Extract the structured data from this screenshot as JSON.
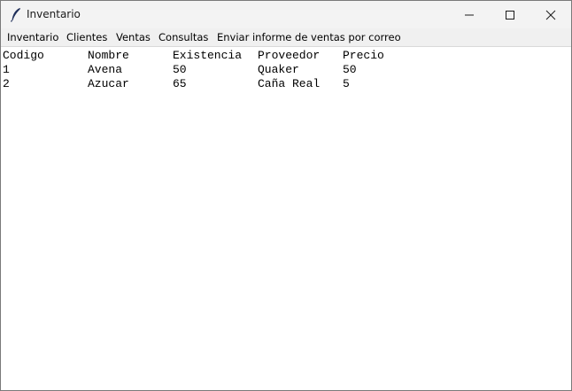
{
  "window": {
    "title": "Inventario",
    "icons": {
      "app": "feather-icon",
      "minimize": "minimize-icon",
      "maximize": "maximize-icon",
      "close": "close-icon"
    }
  },
  "menu": {
    "items": [
      "Inventario",
      "Clientes",
      "Ventas",
      "Consultas",
      "Enviar informe de ventas por correo"
    ]
  },
  "table": {
    "headers": [
      "Codigo",
      "Nombre",
      "Existencia",
      "Proveedor",
      "Precio"
    ],
    "rows": [
      [
        "1",
        "Avena",
        "50",
        "Quaker",
        "50"
      ],
      [
        "2",
        "Azucar",
        "65",
        "Caña Real",
        "5"
      ]
    ]
  }
}
